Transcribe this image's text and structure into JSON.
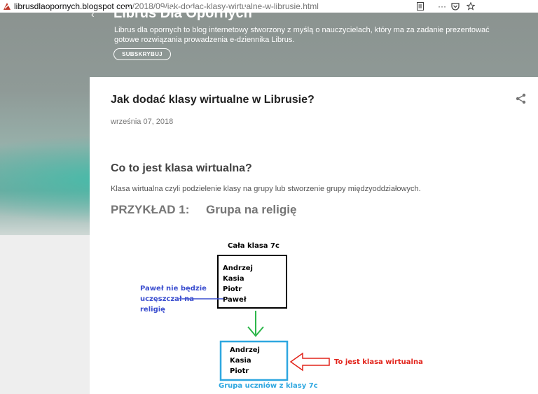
{
  "browser": {
    "url_host": "librusdlaopornych.blogspot.com",
    "url_path": "/2018/09/jak-dodac-klasy-wirtualne-w-librusie.html",
    "menu_glyph": "···"
  },
  "header": {
    "blog_title": "Librus Dla Opornych",
    "description": "Librus dla opornych to blog internetowy stworzony z myślą o nauczycielach, który ma za zadanie prezentować gotowe rozwiązania prowadzenia e-dziennika Librus.",
    "subscribe_label": "SUBSKRYBUJ"
  },
  "post": {
    "title": "Jak dodać klasy wirtualne w Librusie?",
    "date": "września 07, 2018",
    "heading": "Co to jest klasa wirtualna?",
    "paragraph": "Klasa wirtualna czyli podzielenie klasy na grupy lub stworzenie grupy międzyoddziałowych.",
    "example_heading": "PRZYKŁAD 1:     Grupa na religię"
  },
  "diagram": {
    "whole_class_caption": "Cała klasa 7c",
    "whole_class": [
      "Andrzej",
      "Kasia",
      "Piotr",
      "Paweł"
    ],
    "note_lines": [
      "Paweł nie będzie",
      "uczęszczał na",
      "religię"
    ],
    "group": [
      "Andrzej",
      "Kasia",
      "Piotr"
    ],
    "virtual_label": "To jest klasa wirtualna",
    "group_caption": "Grupa uczniów z klasy 7c",
    "colors": {
      "blue": "#3b4ecf",
      "green": "#2db64a",
      "red": "#e2231a",
      "cyan": "#2ea7e0"
    }
  }
}
